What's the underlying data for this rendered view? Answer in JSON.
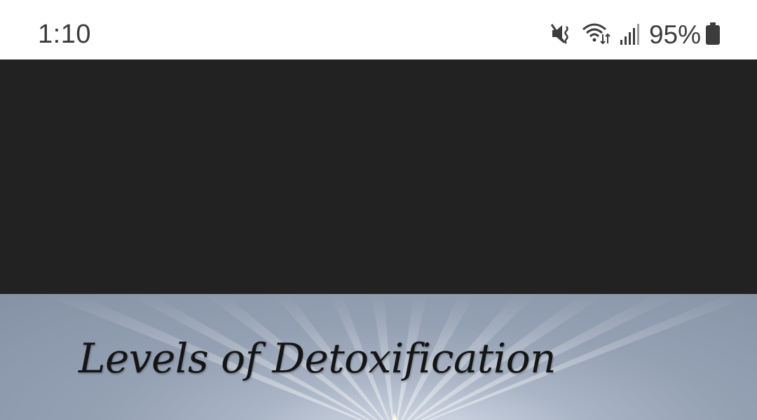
{
  "status_bar": {
    "time": "1:10",
    "battery_percent": "95%",
    "icons": [
      "mute-icon",
      "wifi-icon",
      "signal-icon",
      "battery-icon"
    ]
  },
  "banner": {
    "title": "Levels of Detoxification"
  },
  "colors": {
    "status_bar_bg": "#ffffff",
    "dark_panel_bg": "#222222",
    "banner_bg": "#9aa5b8",
    "status_text": "#3c3c3c",
    "banner_title": "#151515"
  }
}
